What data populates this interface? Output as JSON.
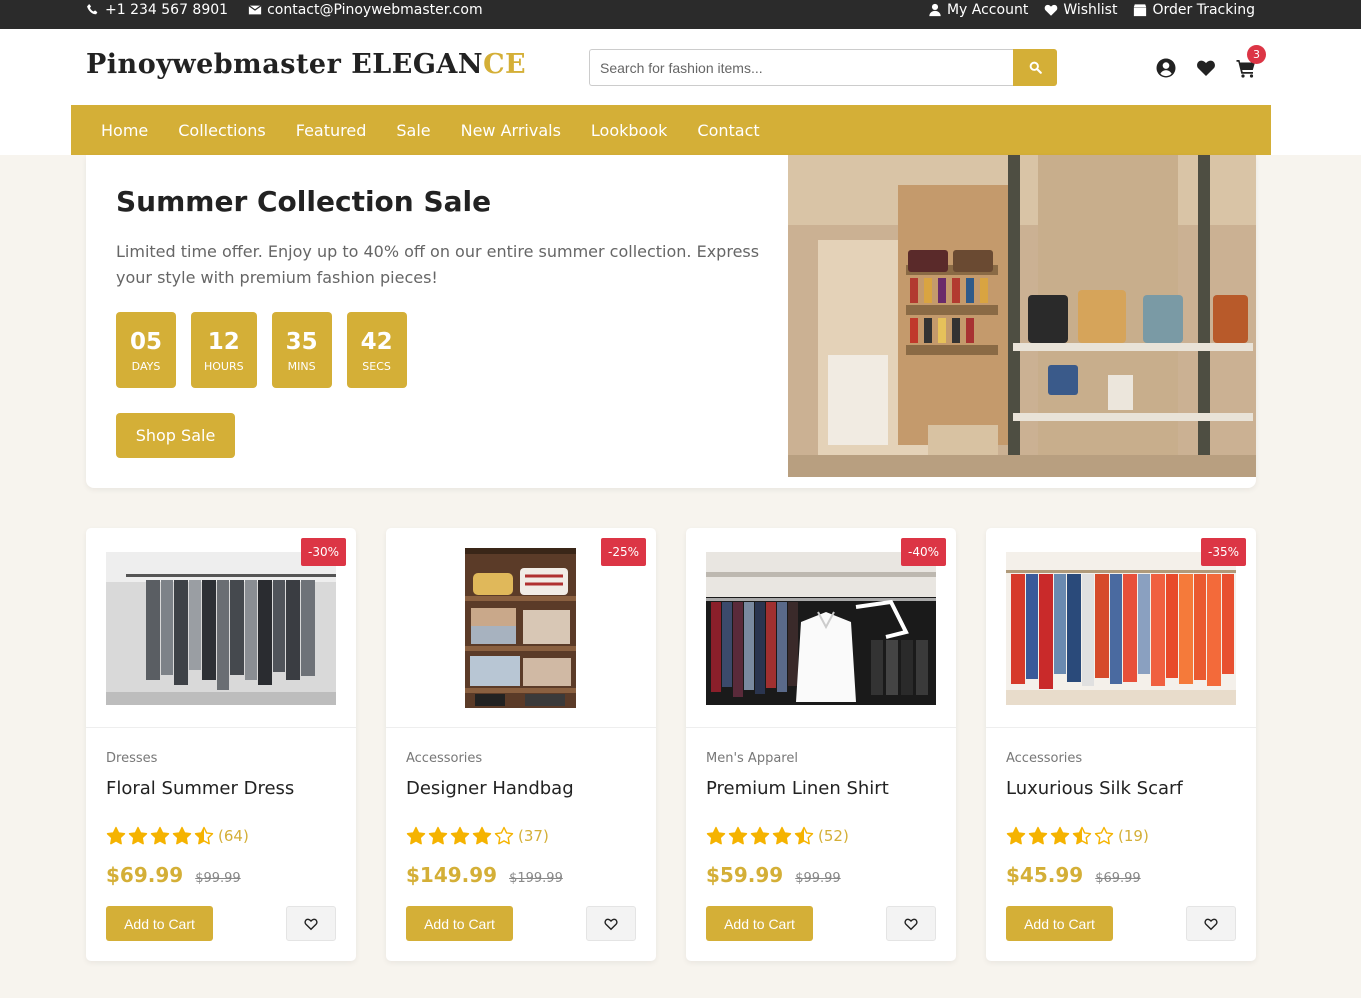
{
  "topbar": {
    "phone": "+1 234 567 8901",
    "email": "contact@Pinoywebmaster.com",
    "my_account": "My Account",
    "wishlist": "Wishlist",
    "order_tracking": "Order Tracking"
  },
  "header": {
    "logo_main": "Pinoywebmaster ELEGAN",
    "logo_accent": "CE",
    "search_placeholder": "Search for fashion items...",
    "cart_count": "3"
  },
  "nav": [
    "Home",
    "Collections",
    "Featured",
    "Sale",
    "New Arrivals",
    "Lookbook",
    "Contact"
  ],
  "hero": {
    "title": "Summer Collection Sale",
    "description": "Limited time offer. Enjoy up to 40% off on our entire summer collection. Express your style with premium fashion pieces!",
    "countdown": [
      {
        "value": "05",
        "label": "DAYS"
      },
      {
        "value": "12",
        "label": "HOURS"
      },
      {
        "value": "35",
        "label": "MINS"
      },
      {
        "value": "42",
        "label": "SECS"
      }
    ],
    "button": "Shop Sale"
  },
  "products": [
    {
      "category": "Dresses",
      "name": "Floral Summer Dress",
      "discount": "-30%",
      "rating": 4.5,
      "reviews": "(64)",
      "price": "$69.99",
      "old_price": "$99.99",
      "add_label": "Add to Cart"
    },
    {
      "category": "Accessories",
      "name": "Designer Handbag",
      "discount": "-25%",
      "rating": 4,
      "reviews": "(37)",
      "price": "$149.99",
      "old_price": "$199.99",
      "add_label": "Add to Cart"
    },
    {
      "category": "Men's Apparel",
      "name": "Premium Linen Shirt",
      "discount": "-40%",
      "rating": 4.5,
      "reviews": "(52)",
      "price": "$59.99",
      "old_price": "$99.99",
      "add_label": "Add to Cart"
    },
    {
      "category": "Accessories",
      "name": "Luxurious Silk Scarf",
      "discount": "-35%",
      "rating": 3.5,
      "reviews": "(19)",
      "price": "$45.99",
      "old_price": "$69.99",
      "add_label": "Add to Cart"
    }
  ],
  "colors": {
    "accent": "#d4af37",
    "badge": "#dc3545",
    "topbar": "#2b2b2b",
    "background": "#f7f4ee"
  }
}
